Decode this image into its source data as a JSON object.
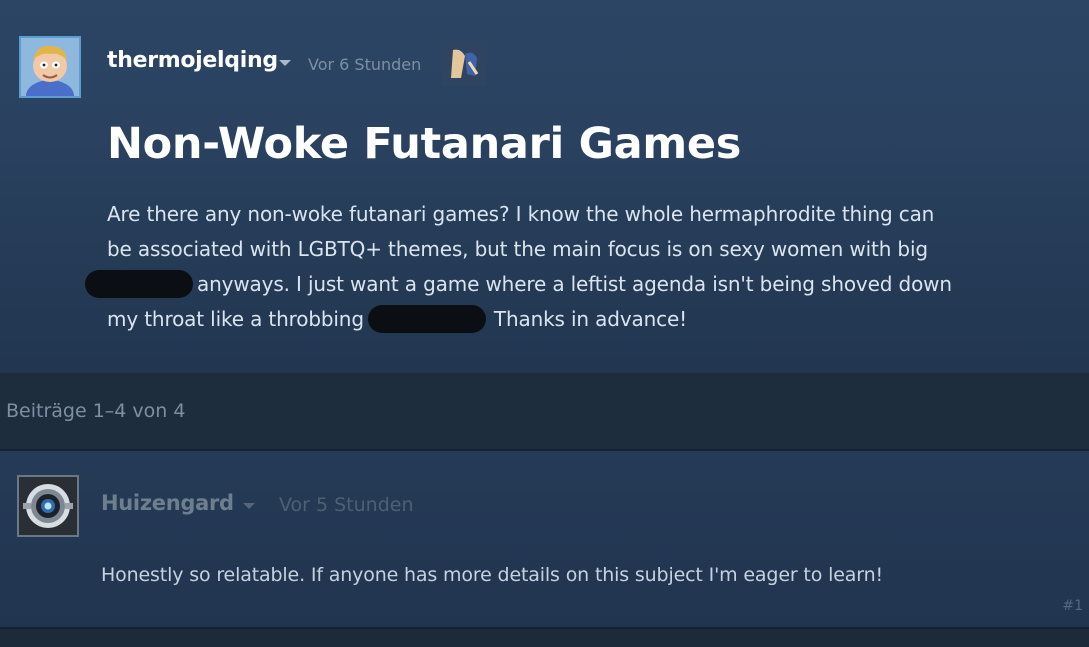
{
  "original_post": {
    "author": "thermojelqing",
    "timestamp": "Vor 6 Stunden",
    "title": "Non-Woke Futanari Games",
    "body_lines": [
      "Are there any non-woke futanari games? I know the whole hermaphrodite thing can",
      "be associated with LGBTQ+ themes, but the main focus is on sexy women with big",
      "anyways. I just want a game where a leftist agenda isn't being shoved down",
      "my throat like a throbbing",
      "Thanks in advance!"
    ]
  },
  "reply_count": {
    "text": "Beiträge 1–4 von 4"
  },
  "reply": {
    "author": "Huizengard",
    "timestamp": "Vor 5 Stunden",
    "body": "Honestly so relatable. If anyone has more details on this subject I'm eager to learn!",
    "number": "#1"
  },
  "colors": {
    "op_background": "#2a4260",
    "count_bar_background": "#1e2d3e",
    "reply_background": "#233852",
    "accent_avatar_border": "#5d9bd0"
  },
  "icons": {
    "op_avatar": "cartoon-avatar",
    "award": "award-badge-icon",
    "reply_avatar": "robot-eye-avatar",
    "dropdown": "chevron-down-icon"
  }
}
